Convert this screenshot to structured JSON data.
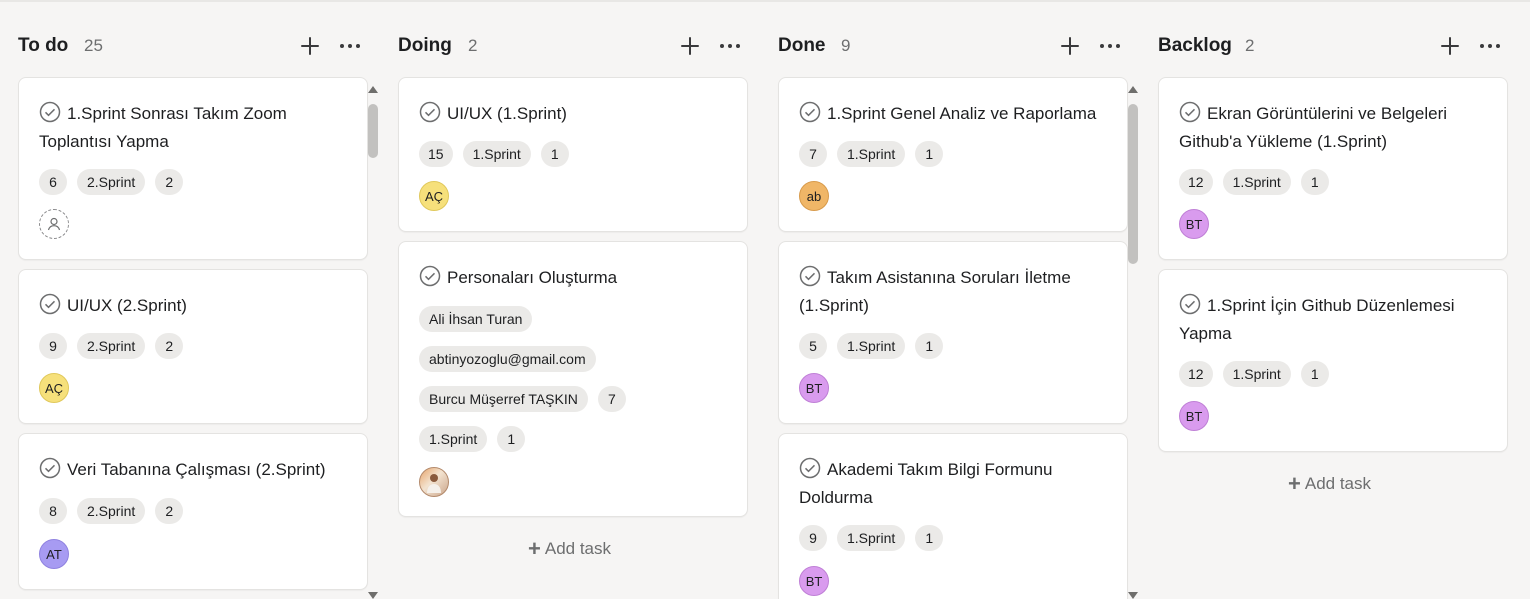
{
  "columns": [
    {
      "title": "To do",
      "count": "25",
      "cards": [
        {
          "title": "1.Sprint Sonrası Takım Zoom Toplantısı Yapma",
          "chips": [
            "6",
            "2.Sprint",
            "2"
          ],
          "assignee": ""
        },
        {
          "title": "UI/UX (2.Sprint)",
          "chips": [
            "9",
            "2.Sprint",
            "2"
          ],
          "assignee": "AÇ"
        },
        {
          "title": "Veri Tabanına Çalışması (2.Sprint)",
          "chips": [
            "8",
            "2.Sprint",
            "2"
          ],
          "assignee": "AT"
        }
      ]
    },
    {
      "title": "Doing",
      "count": "2",
      "cards": [
        {
          "title": "UI/UX (1.Sprint)",
          "chips": [
            "15",
            "1.Sprint",
            "1"
          ],
          "assignee": "AÇ"
        },
        {
          "title": "Personaları Oluşturma",
          "chip_rows": [
            [
              "Ali İhsan Turan"
            ],
            [
              "abtinyozoglu@gmail.com"
            ],
            [
              "Burcu Müşerref TAŞKIN",
              "7"
            ],
            [
              "1.Sprint",
              "1"
            ]
          ],
          "assignee": ""
        }
      ],
      "add_task": "Add task"
    },
    {
      "title": "Done",
      "count": "9",
      "cards": [
        {
          "title": "1.Sprint Genel Analiz ve Raporlama",
          "chips": [
            "7",
            "1.Sprint",
            "1"
          ],
          "assignee": "ab"
        },
        {
          "title": "Takım Asistanına Soruları İletme (1.Sprint)",
          "chips": [
            "5",
            "1.Sprint",
            "1"
          ],
          "assignee": "BT"
        },
        {
          "title": "Akademi Takım Bilgi Formunu Doldurma",
          "chips": [
            "9",
            "1.Sprint",
            "1"
          ],
          "assignee": "BT"
        }
      ]
    },
    {
      "title": "Backlog",
      "count": "2",
      "cards": [
        {
          "title": "Ekran Görüntülerini ve Belgeleri Github'a Yükleme (1.Sprint)",
          "chips": [
            "12",
            "1.Sprint",
            "1"
          ],
          "assignee": "BT"
        },
        {
          "title": "1.Sprint İçin Github Düzenlemesi Yapma",
          "chips": [
            "12",
            "1.Sprint",
            "1"
          ],
          "assignee": "BT"
        }
      ],
      "add_task": "Add task"
    }
  ],
  "avatar_colors": {
    "AÇ": "#f6e07b",
    "AT": "#a79bf2",
    "ab": "#f0b667",
    "BT": "#d99bee"
  }
}
